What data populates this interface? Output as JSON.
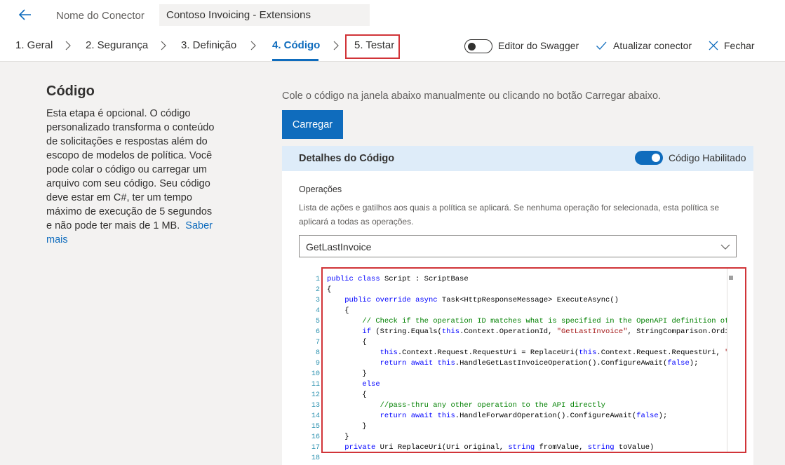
{
  "header": {
    "back_icon": "arrow-left-icon",
    "connector_label": "Nome do Conector",
    "connector_name": "Contoso Invoicing - Extensions"
  },
  "tabs": [
    {
      "label": "1. Geral"
    },
    {
      "label": "2. Segurança"
    },
    {
      "label": "3. Definição"
    },
    {
      "label": "4. Código",
      "active": true
    },
    {
      "label": "5. Testar"
    }
  ],
  "actions": {
    "swagger_editor": "Editor do Swagger",
    "update_connector": "Atualizar conector",
    "close": "Fechar"
  },
  "sidebar": {
    "title": "Código",
    "description": "Esta etapa é opcional. O código personalizado transforma o conteúdo de solicitações e respostas além do escopo de modelos de política. Você pode colar o código ou carregar um arquivo com seu código. Seu código deve estar em C#, ter um tempo máximo de execução de 5 segundos e não pode ter mais de 1 MB.",
    "learn_more": "Saber mais"
  },
  "main": {
    "instruction": "Cole o código na janela abaixo manualmente ou clicando no botão Carregar abaixo.",
    "upload_button": "Carregar",
    "panel_title": "Detalhes do Código",
    "code_enabled_label": "Código Habilitado",
    "operations_label": "Operações",
    "operations_desc": "Lista de ações e gatilhos aos quais a política se aplicará. Se nenhuma operação for selecionada, esta política se aplicará a todas as operações.",
    "operation_selected": "GetLastInvoice"
  },
  "colors": {
    "accent": "#0f6cbd",
    "highlight_border": "#d13438",
    "panel_header": "#deecf9"
  },
  "code_lines": [
    "1",
    "2",
    "3",
    "4",
    "5",
    "6",
    "7",
    "8",
    "9",
    "10",
    "11",
    "12",
    "13",
    "14",
    "15",
    "16",
    "17",
    "18"
  ]
}
